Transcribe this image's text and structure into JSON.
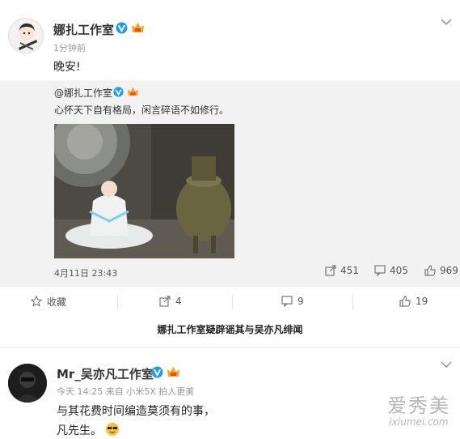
{
  "post1": {
    "username": "娜扎工作室",
    "time": "1分钟前",
    "text": "晚安!"
  },
  "repost": {
    "username": "@娜扎工作室",
    "text": "心怀天下自有格局，闲言碎语不如修行。",
    "date": "4月11日 23:43",
    "stats": {
      "reposts": "451",
      "comments": "405",
      "likes": "969"
    }
  },
  "actions": {
    "favorite": "收藏",
    "repost": "4",
    "comment": "9",
    "like": "19"
  },
  "caption": "娜扎工作室疑辟谣其与吴亦凡绯闻",
  "post2": {
    "username": "Mr_吴亦凡工作室",
    "meta": "今天 14:25 来自 小米5X 拍人更美",
    "text_line1": "与其花费时间编造莫须有的事，",
    "text_line2": "凡先生。"
  },
  "watermark": {
    "cn": "爱秀美",
    "en": "ixiumei.com"
  },
  "colors": {
    "vip_orange": "#f5a623",
    "verified_blue": "#1d9cf0",
    "bg_gray": "#f2f2f2"
  }
}
